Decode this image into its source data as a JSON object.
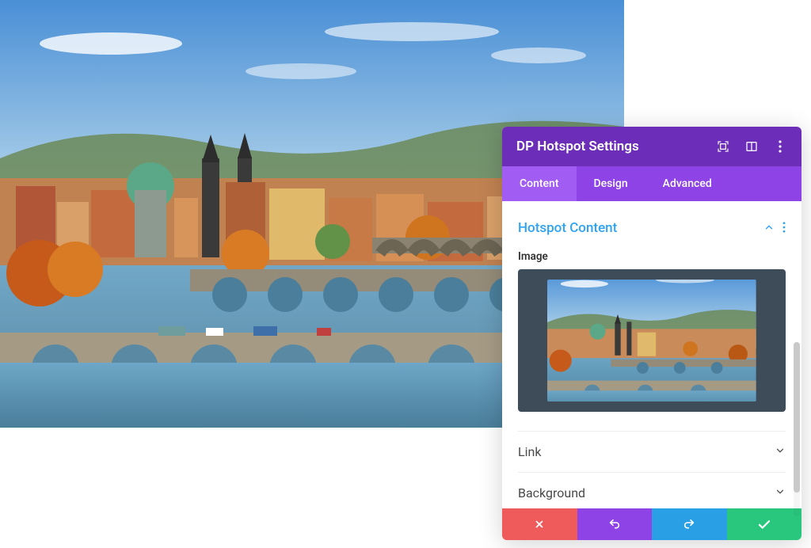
{
  "panel": {
    "title": "DP Hotspot Settings"
  },
  "tabs": {
    "content": "Content",
    "design": "Design",
    "advanced": "Advanced"
  },
  "sections": {
    "hotspot_content": {
      "title": "Hotspot Content",
      "image_label": "Image"
    },
    "link": {
      "title": "Link"
    },
    "background": {
      "title": "Background"
    }
  }
}
